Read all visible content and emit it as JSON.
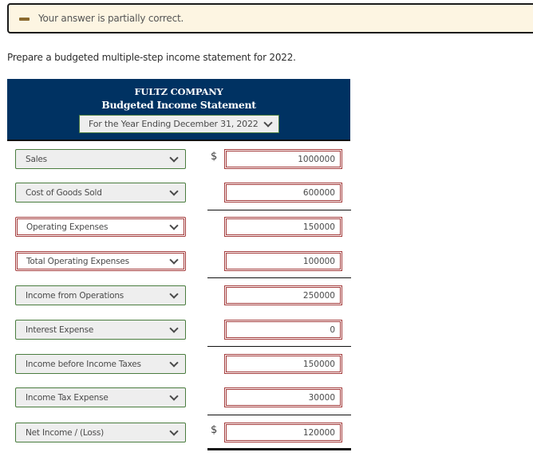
{
  "feedback": {
    "icon": "partial-correct-dash-icon",
    "message": "Your answer is partially correct.",
    "accent_color": "#8b6a2f",
    "background_color": "#fdf5e2"
  },
  "prompt": "Prepare a budgeted multiple-step income statement for 2022.",
  "statement": {
    "company": "FULTZ COMPANY",
    "title": "Budgeted Income Statement",
    "period_select": "For the Year Ending December 31, 2022",
    "header_color": "#003262",
    "currency_symbol": "$",
    "rows": [
      {
        "account": "Sales",
        "amount": "1000000",
        "account_status": "correct",
        "amount_status": "incorrect",
        "show_dollar": true
      },
      {
        "account": "Cost of Goods Sold",
        "amount": "600000",
        "account_status": "correct",
        "amount_status": "incorrect",
        "show_dollar": false
      },
      {
        "account": "Operating Expenses",
        "amount": "150000",
        "account_status": "incorrect",
        "amount_status": "incorrect",
        "show_dollar": false
      },
      {
        "account": "Total Operating Expenses",
        "amount": "100000",
        "account_status": "incorrect",
        "amount_status": "incorrect",
        "show_dollar": false
      },
      {
        "account": "Income from Operations",
        "amount": "250000",
        "account_status": "correct",
        "amount_status": "incorrect",
        "show_dollar": false
      },
      {
        "account": "Interest Expense",
        "amount": "0",
        "account_status": "correct",
        "amount_status": "incorrect",
        "show_dollar": false
      },
      {
        "account": "Income before Income Taxes",
        "amount": "150000",
        "account_status": "correct",
        "amount_status": "incorrect",
        "show_dollar": false
      },
      {
        "account": "Income Tax Expense",
        "amount": "30000",
        "account_status": "correct",
        "amount_status": "incorrect",
        "show_dollar": false
      },
      {
        "account": "Net Income / (Loss)",
        "amount": "120000",
        "account_status": "correct",
        "amount_status": "incorrect",
        "show_dollar": true
      }
    ]
  },
  "colors": {
    "correct_border": "#4a7d3f",
    "incorrect_border": "#a33a3a"
  }
}
